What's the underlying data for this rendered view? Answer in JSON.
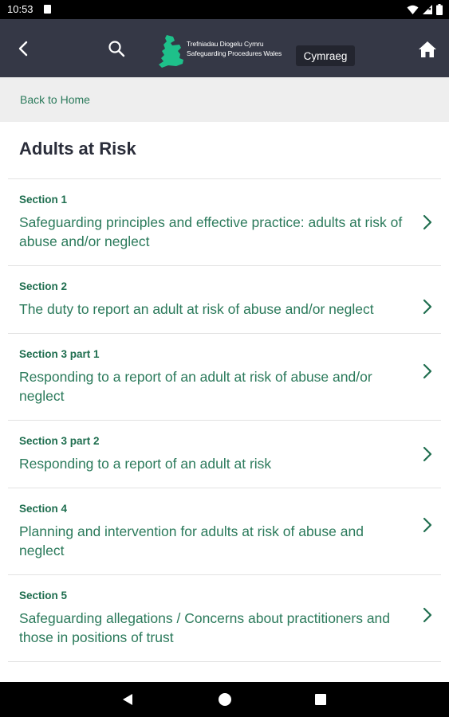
{
  "status_bar": {
    "time": "10:53",
    "icons": [
      "sd-card-icon",
      "wifi-icon",
      "signal-icon",
      "battery-icon"
    ]
  },
  "app_bar": {
    "logo_line1": "Trefniadau Diogelu Cymru",
    "logo_line2": "Safeguarding Procedures Wales",
    "language_button": "Cymraeg",
    "background_color": "#353846",
    "logo_color": "#1ec08a"
  },
  "breadcrumb": {
    "label": "Back to Home"
  },
  "page": {
    "title": "Adults at Risk"
  },
  "sections": [
    {
      "label": "Section 1",
      "title": "Safeguarding principles and effective practice: adults at risk of abuse and/or neglect"
    },
    {
      "label": "Section 2",
      "title": "The duty to report an adult at risk of abuse and/or neglect"
    },
    {
      "label": "Section 3 part 1",
      "title": "Responding to a report of an adult at risk of abuse and/or neglect"
    },
    {
      "label": "Section 3 part 2",
      "title": "Responding to a report of an adult at risk"
    },
    {
      "label": "Section 4",
      "title": "Planning and intervention for adults at risk of abuse and neglect"
    },
    {
      "label": "Section 5",
      "title": "Safeguarding allegations / Concerns about practitioners and those in positions of trust"
    }
  ],
  "colors": {
    "accent": "#2b7a5b",
    "title_text": "#2a2d3a",
    "breadcrumb_bg": "#eeeeee"
  }
}
